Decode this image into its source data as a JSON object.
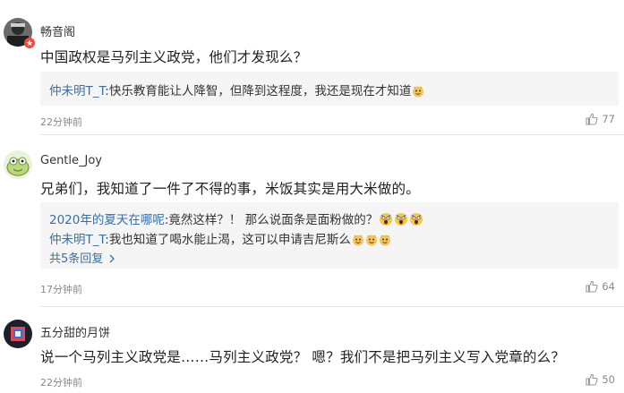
{
  "comments": [
    {
      "username": "畅音阁",
      "text": "中国政权是马列主义政党，他们才发现么？",
      "replies": [
        {
          "author": "仲未明T_T",
          "text": ":快乐教育能让人降智，但降到这程度，我还是现在才知道"
        }
      ],
      "time": "22分钟前",
      "likes": "77"
    },
    {
      "username": "Gentle_Joy",
      "text": "兄弟们，我知道了一件了不得的事，米饭其实是用大米做的。",
      "replies": [
        {
          "author": "2020年的夏天在哪呢",
          "text": ":竟然这样？！ 那么说面条是面粉做的？"
        },
        {
          "author": "仲未明T_T",
          "text": ":我也知道了喝水能止渴，这可以申请吉尼斯么"
        }
      ],
      "more": "共5条回复",
      "time": "17分钟前",
      "likes": "64"
    },
    {
      "username": "五分甜的月饼",
      "text": "说一个马列主义政党是……马列主义政党？ 嗯？我们不是把马列主义写入党章的么？",
      "time": "22分钟前",
      "likes": "50"
    }
  ],
  "icons": {
    "like": "thumbs-up-icon",
    "emoji_doge": "doge-emoji-icon",
    "emoji_shock": "shocked-emoji-icon",
    "chevron": "chevron-right-icon"
  },
  "colors": {
    "link_blue": "#3a6ea5",
    "reply_bg": "#f5f5f5",
    "meta_gray": "#888888"
  }
}
